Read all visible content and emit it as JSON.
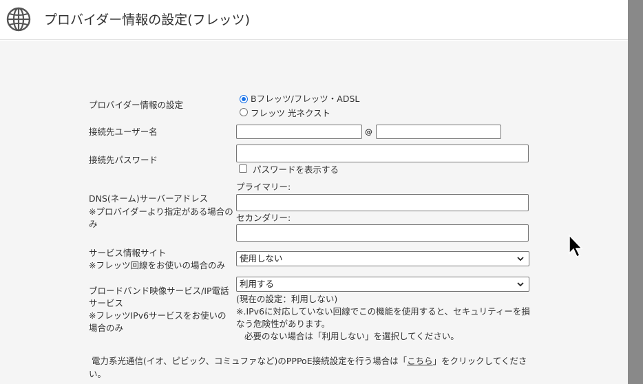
{
  "header": {
    "title": "プロバイダー情報の設定(フレッツ)"
  },
  "form": {
    "provider": {
      "label": "プロバイダー情報の設定",
      "options": [
        "Bフレッツ/フレッツ・ADSL",
        "フレッツ 光ネクスト"
      ],
      "selected": "Bフレッツ/フレッツ・ADSL"
    },
    "username": {
      "label": "接続先ユーザー名",
      "at": "@",
      "value_user": "",
      "value_domain": ""
    },
    "password": {
      "label": "接続先パスワード",
      "value": "",
      "show_label": "パスワードを表示する"
    },
    "dns": {
      "label_line1": "DNS(ネーム)サーバーアドレス",
      "label_line2": "※プロバイダーより指定がある場合の",
      "label_line3": "み",
      "primary_label": "プライマリー:",
      "secondary_label": "セカンダリー:",
      "primary_value": "",
      "secondary_value": ""
    },
    "service_site": {
      "label_line1": "サービス情報サイト",
      "label_line2": "※フレッツ回線をお使いの場合のみ",
      "selected": "使用しない"
    },
    "broadband": {
      "label_line1": "ブロードバンド映像サービス/IP電話",
      "label_line2": "サービス",
      "label_line3": "※フレッツIPv6サービスをお使いの",
      "label_line4": "場合のみ",
      "selected": "利用する",
      "current": "(現在の設定：利用しない)",
      "note1": "※.IPv6に対応していない回線でこの機能を使用すると、セキュリティーを損",
      "note2": "なう危険性があります。",
      "note3": "必要のない場合は「利用しない」を選択してください。"
    },
    "footer": {
      "text1_pre": "電力系光通信(イオ、ピビック、コミュファなど)のPPPoE接続設定を行う場合は「",
      "text1_link": "こちら",
      "text1_post": "」をクリックしてくださ",
      "text2": "い。"
    }
  },
  "colors": {
    "radio_accent": "#1a73e8",
    "scrollbar": "#898989",
    "background": "#f5f5f5"
  }
}
